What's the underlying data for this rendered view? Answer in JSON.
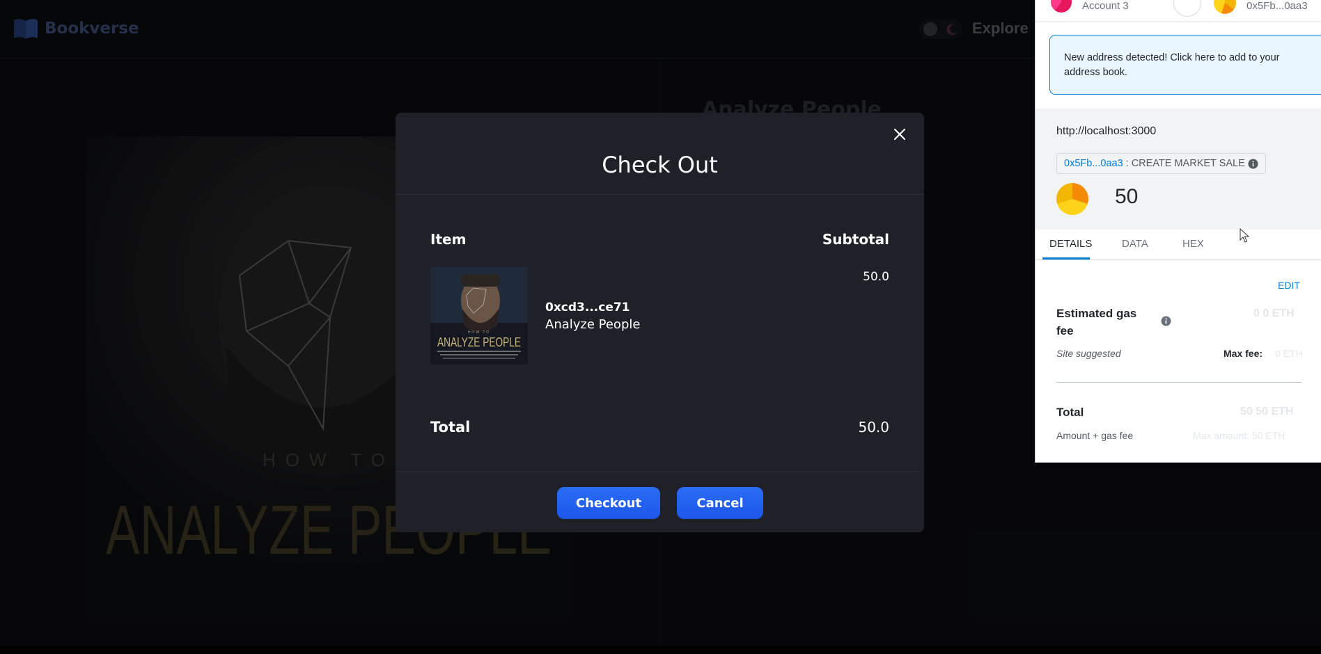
{
  "app": {
    "logo_text": "Bookverse",
    "nav_explore": "Explore"
  },
  "background": {
    "product_title": "Analyze People"
  },
  "modal": {
    "title": "Check Out",
    "col_item": "Item",
    "col_subtotal": "Subtotal",
    "items": [
      {
        "address": "0xcd3...ce71",
        "name": "Analyze People",
        "subtotal": "50.0",
        "cover_line_small": "HOW TO",
        "cover_line_big": "ANALYZE PEOPLE"
      }
    ],
    "total_label": "Total",
    "total_value": "50.0",
    "checkout_label": "Checkout",
    "cancel_label": "Cancel"
  },
  "wallet": {
    "account_name": "Account 3",
    "dest_address": "0x5Fb...0aa3",
    "notice": "New address detected! Click here to add to your address book.",
    "origin": "http://localhost:3000",
    "method_address": "0x5Fb...0aa3",
    "method_name": ": CREATE MARKET SALE",
    "amount": "50",
    "tabs": [
      "DETAILS",
      "DATA",
      "HEX"
    ],
    "edit_label": "EDIT",
    "gas_label": "Estimated gas fee",
    "gas_value": "0  0 ETH",
    "site_suggested": "Site suggested",
    "max_fee_label": "Max fee:",
    "max_fee_value": "0 ETH",
    "total_label": "Total",
    "total_value": "50  50 ETH",
    "amount_gas_label": "Amount + gas fee",
    "max_amount": "Max amount:  50 ETH"
  },
  "colors": {
    "accent_blue": "#1d57e8",
    "wallet_blue": "#037dd6",
    "modal_bg": "#1f2028"
  }
}
